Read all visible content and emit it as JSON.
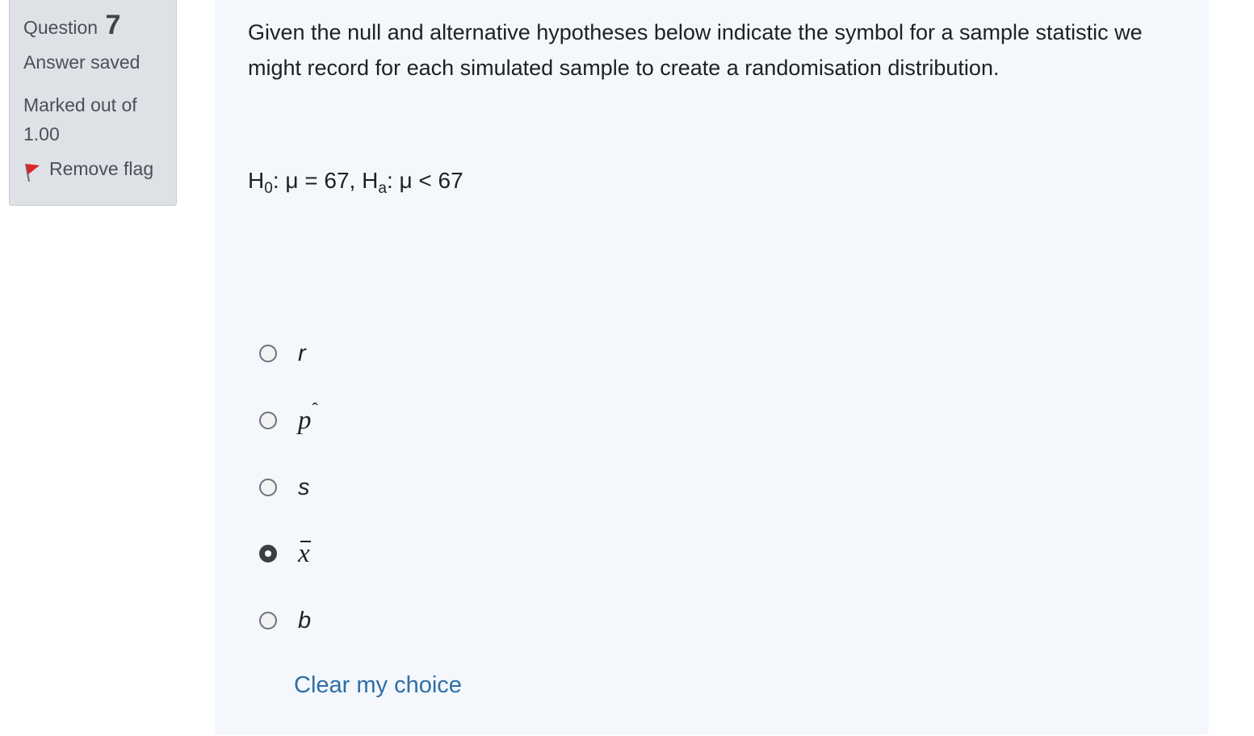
{
  "info": {
    "question_label": "Question",
    "question_number": "7",
    "state": "Answer saved",
    "grade_line1": "Marked out of",
    "grade_line2": "1.00",
    "flag_label": "Remove flag"
  },
  "question": {
    "text": "Given the null and alternative hypotheses below indicate the symbol for a sample statistic we might record for each simulated sample to create a randomisation distribution.",
    "hypothesis": {
      "h_null": "H",
      "h_null_sub": "0",
      "h_null_expr": ": μ = 67, ",
      "h_alt": "H",
      "h_alt_sub": "a",
      "h_alt_expr": ": μ < 67"
    }
  },
  "options": [
    {
      "symbol": "r",
      "selected": false
    },
    {
      "symbol": "p",
      "hat": "ˆ",
      "selected": false
    },
    {
      "symbol": "s",
      "selected": false
    },
    {
      "symbol": "x",
      "selected": true
    },
    {
      "symbol": "b",
      "selected": false
    }
  ],
  "clear_label": "Clear my choice",
  "colors": {
    "link": "#2f6ea5",
    "flag": "#d9252b",
    "panel_bg": "#f4f8fd",
    "info_bg": "#dee2e6"
  }
}
